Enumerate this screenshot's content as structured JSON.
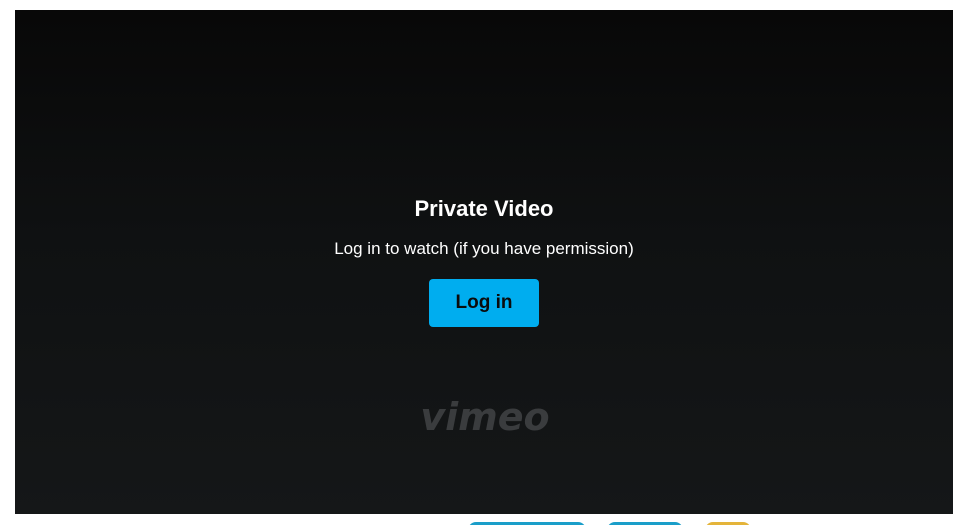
{
  "player": {
    "title": "Private Video",
    "message": "Log in to watch (if you have permission)",
    "login_label": "Log in",
    "logo_text": "vimeo"
  },
  "colors": {
    "accent": "#00adef",
    "background": "#0f1112",
    "logo": "#3a3c3e"
  }
}
